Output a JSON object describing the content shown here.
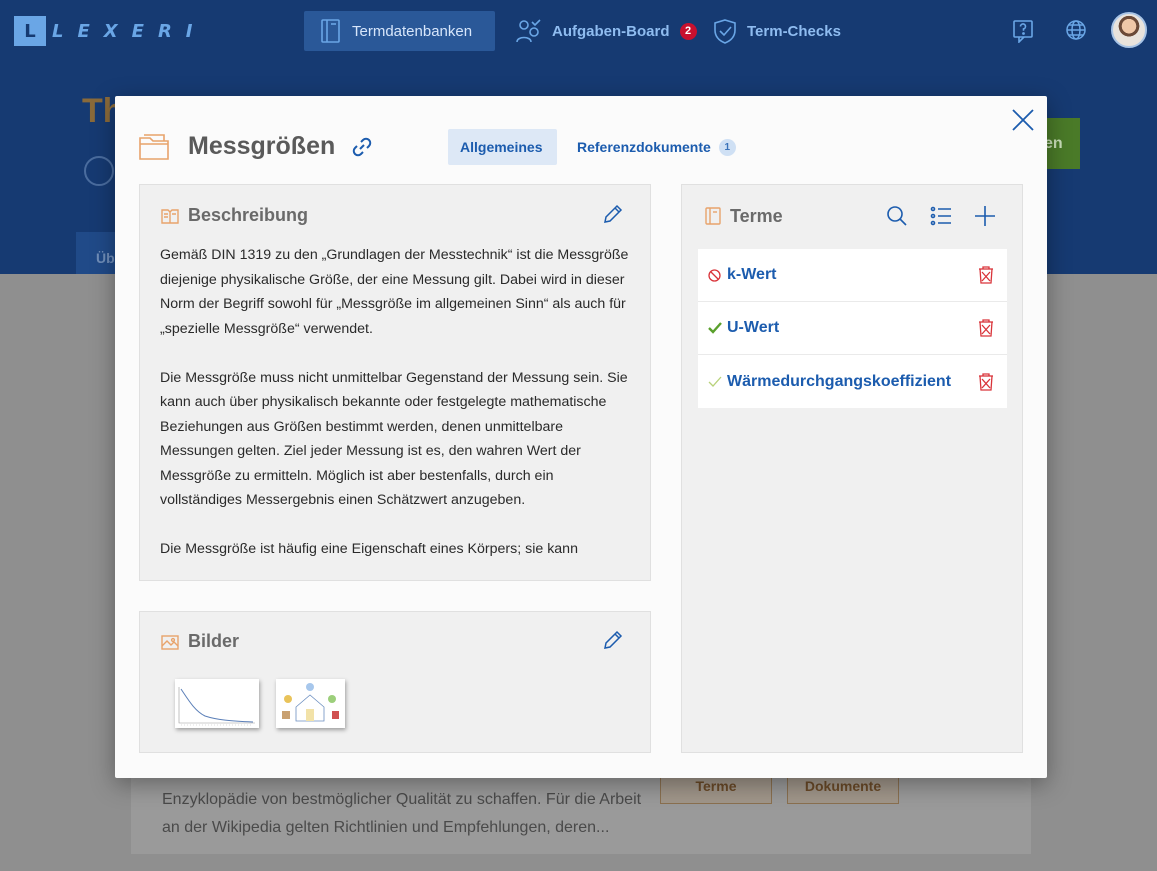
{
  "app": {
    "logo_mark": "L",
    "logo_text": "LEXERI"
  },
  "nav": {
    "items": [
      {
        "label": "Termdatenbanken",
        "icon": "database-book-icon",
        "active": true
      },
      {
        "label": "Aufgaben-Board",
        "icon": "team-task-icon",
        "badge": "2"
      },
      {
        "label": "Term-Checks",
        "icon": "shield-check-icon"
      }
    ],
    "right_icons": [
      "help-icon",
      "globe-icon",
      "user-avatar"
    ]
  },
  "background": {
    "title": "Th",
    "green_button": "en",
    "tab": "Üb",
    "card_text": "Enzyklopädie von bestmöglicher Qualität zu schaffen. Für die Arbeit an der Wikipedia gelten Richtlinien und Empfehlungen, deren...",
    "chips": [
      "Terme",
      "Dokumente"
    ]
  },
  "modal": {
    "title": "Messgrößen",
    "tabs": [
      {
        "label": "Allgemeines",
        "active": true
      },
      {
        "label": "Referenzdokumente",
        "count": "1"
      }
    ],
    "description": {
      "heading": "Beschreibung",
      "paragraphs": [
        "Gemäß DIN 1319 zu den „Grundlagen der Messtechnik“ ist die Messgröße diejenige physikalische Größe, der eine Messung gilt. Dabei wird in dieser Norm der Begriff sowohl für „Messgröße im allgemeinen Sinn“ als auch für „spezielle Messgröße“ verwendet.",
        "Die Messgröße muss nicht unmittelbar Gegenstand der Messung sein. Sie kann auch über physikalisch bekannte oder festgelegte mathematische Beziehungen aus Größen bestimmt werden, denen unmittelbare Messungen gelten. Ziel jeder Messung ist es, den wahren Wert der Messgröße zu ermitteln. Möglich ist aber bestenfalls, durch ein vollständiges Messergebnis einen Schätzwert anzugeben.",
        "Die Messgröße ist häufig eine Eigenschaft eines Körpers; sie kann"
      ]
    },
    "images": {
      "heading": "Bilder",
      "thumbnails": [
        "line-chart-thumbnail",
        "house-diagram-thumbnail"
      ]
    },
    "terms": {
      "heading": "Terme",
      "items": [
        {
          "label": "k-Wert",
          "status": "forbidden",
          "status_color": "#d9343a"
        },
        {
          "label": "U-Wert",
          "status": "preferred",
          "status_color": "#5aa02c"
        },
        {
          "label": "Wärmedurchgangskoeffizient",
          "status": "allowed",
          "status_color": "#b8d27a"
        }
      ]
    }
  },
  "colors": {
    "nav_bg": "#163a72",
    "accent": "#1c5cae",
    "icon_orange": "#e8a36b",
    "delete_red": "#d9343a"
  }
}
